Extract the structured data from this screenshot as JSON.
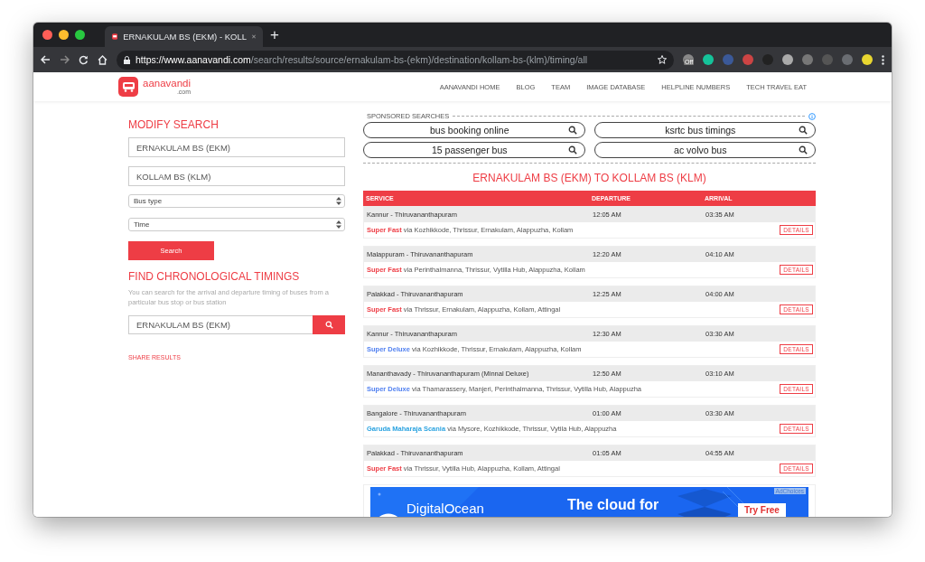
{
  "browser": {
    "tab_title": "ERNAKULAM BS (EKM) - KOLL",
    "new_tab": "+",
    "url_host": "https://www.aanavandi.com",
    "url_path": "/search/results/source/ernakulam-bs-(ekm)/destination/kollam-bs-(klm)/timing/all",
    "extension_badge": "Off"
  },
  "site": {
    "logo_text": "aanavandi",
    "logo_sub": ".com",
    "nav": [
      "AANAVANDI HOME",
      "BLOG",
      "TEAM",
      "IMAGE DATABASE",
      "HELPLINE NUMBERS",
      "TECH TRAVEL EAT"
    ]
  },
  "modify_search": {
    "title": "MODIFY SEARCH",
    "from": "ERNAKULAM BS (EKM)",
    "to": "KOLLAM BS (KLM)",
    "bus_type": "Bus type",
    "time": "Time",
    "button": "Search"
  },
  "chronological": {
    "title": "FIND CHRONOLOGICAL TIMINGS",
    "description": "You can search for the arrival and departure timing of buses from a particular bus stop or bus station",
    "value": "ERNAKULAM BS (EKM)"
  },
  "share": "SHARE RESULTS",
  "sponsored": {
    "label": "SPONSORED SEARCHES",
    "items": [
      "bus booking online",
      "ksrtc bus timings",
      "15 passenger bus",
      "ac volvo bus"
    ]
  },
  "results": {
    "title": "ERNAKULAM BS (EKM) TO KOLLAM BS (KLM)",
    "columns": [
      "SERVICE",
      "DEPARTURE",
      "ARRIVAL"
    ],
    "rows": [
      {
        "route": "Kannur - Thiruvananthapuram",
        "departure": "12:05 AM",
        "arrival": "03:35 AM",
        "type": "Super Fast",
        "color": "#ee3d45",
        "via": "via Kozhikkode, Thrissur, Ernakulam, Alappuzha, Kollam",
        "details": "DETAILS"
      },
      {
        "route": "Malappuram - Thiruvananthapuram",
        "departure": "12:20 AM",
        "arrival": "04:10 AM",
        "type": "Super Fast",
        "color": "#ee3d45",
        "via": "via Perinthalmanna, Thrissur, Vytilla Hub, Alappuzha, Kollam",
        "details": "DETAILS"
      },
      {
        "route": "Palakkad - Thiruvananthapuram",
        "departure": "12:25 AM",
        "arrival": "04:00 AM",
        "type": "Super Fast",
        "color": "#ee3d45",
        "via": "via Thrissur, Ernakulam, Alappuzha, Kollam, Attingal",
        "details": "DETAILS"
      },
      {
        "route": "Kannur - Thiruvananthapuram",
        "departure": "12:30 AM",
        "arrival": "03:30 AM",
        "type": "Super Deluxe",
        "color": "#4f7ff0",
        "via": "via Kozhikkode, Thrissur, Ernakulam, Alappuzha, Kollam",
        "details": "DETAILS"
      },
      {
        "route": "Mananthavady - Thiruvananthapuram (Minnal Deluxe)",
        "departure": "12:50 AM",
        "arrival": "03:10 AM",
        "type": "Super Deluxe",
        "color": "#4f7ff0",
        "via": "via Thamarassery, Manjeri, Perinthalmanna, Thrissur, Vytilla Hub, Alappuzha",
        "details": "DETAILS"
      },
      {
        "route": "Bangalore - Thiruvananthapuram",
        "departure": "01:00 AM",
        "arrival": "03:30 AM",
        "type": "Garuda Maharaja Scania",
        "color": "#2ba3e0",
        "via": "via Mysore, Kozhikkode, Thrissur, Vytila Hub, Alappuzha",
        "details": "DETAILS"
      },
      {
        "route": "Palakkad - Thiruvananthapuram",
        "departure": "01:05 AM",
        "arrival": "04:55 AM",
        "type": "Super Fast",
        "color": "#ee3d45",
        "via": "via Thrissur, Vytilla Hub, Alappuzha, Kollam, Attingal",
        "details": "DETAILS"
      }
    ]
  },
  "ad": {
    "brand": "DigitalOcean",
    "headline": "The cloud for",
    "cta": "Try Free",
    "adchoices": "AdChoices"
  }
}
